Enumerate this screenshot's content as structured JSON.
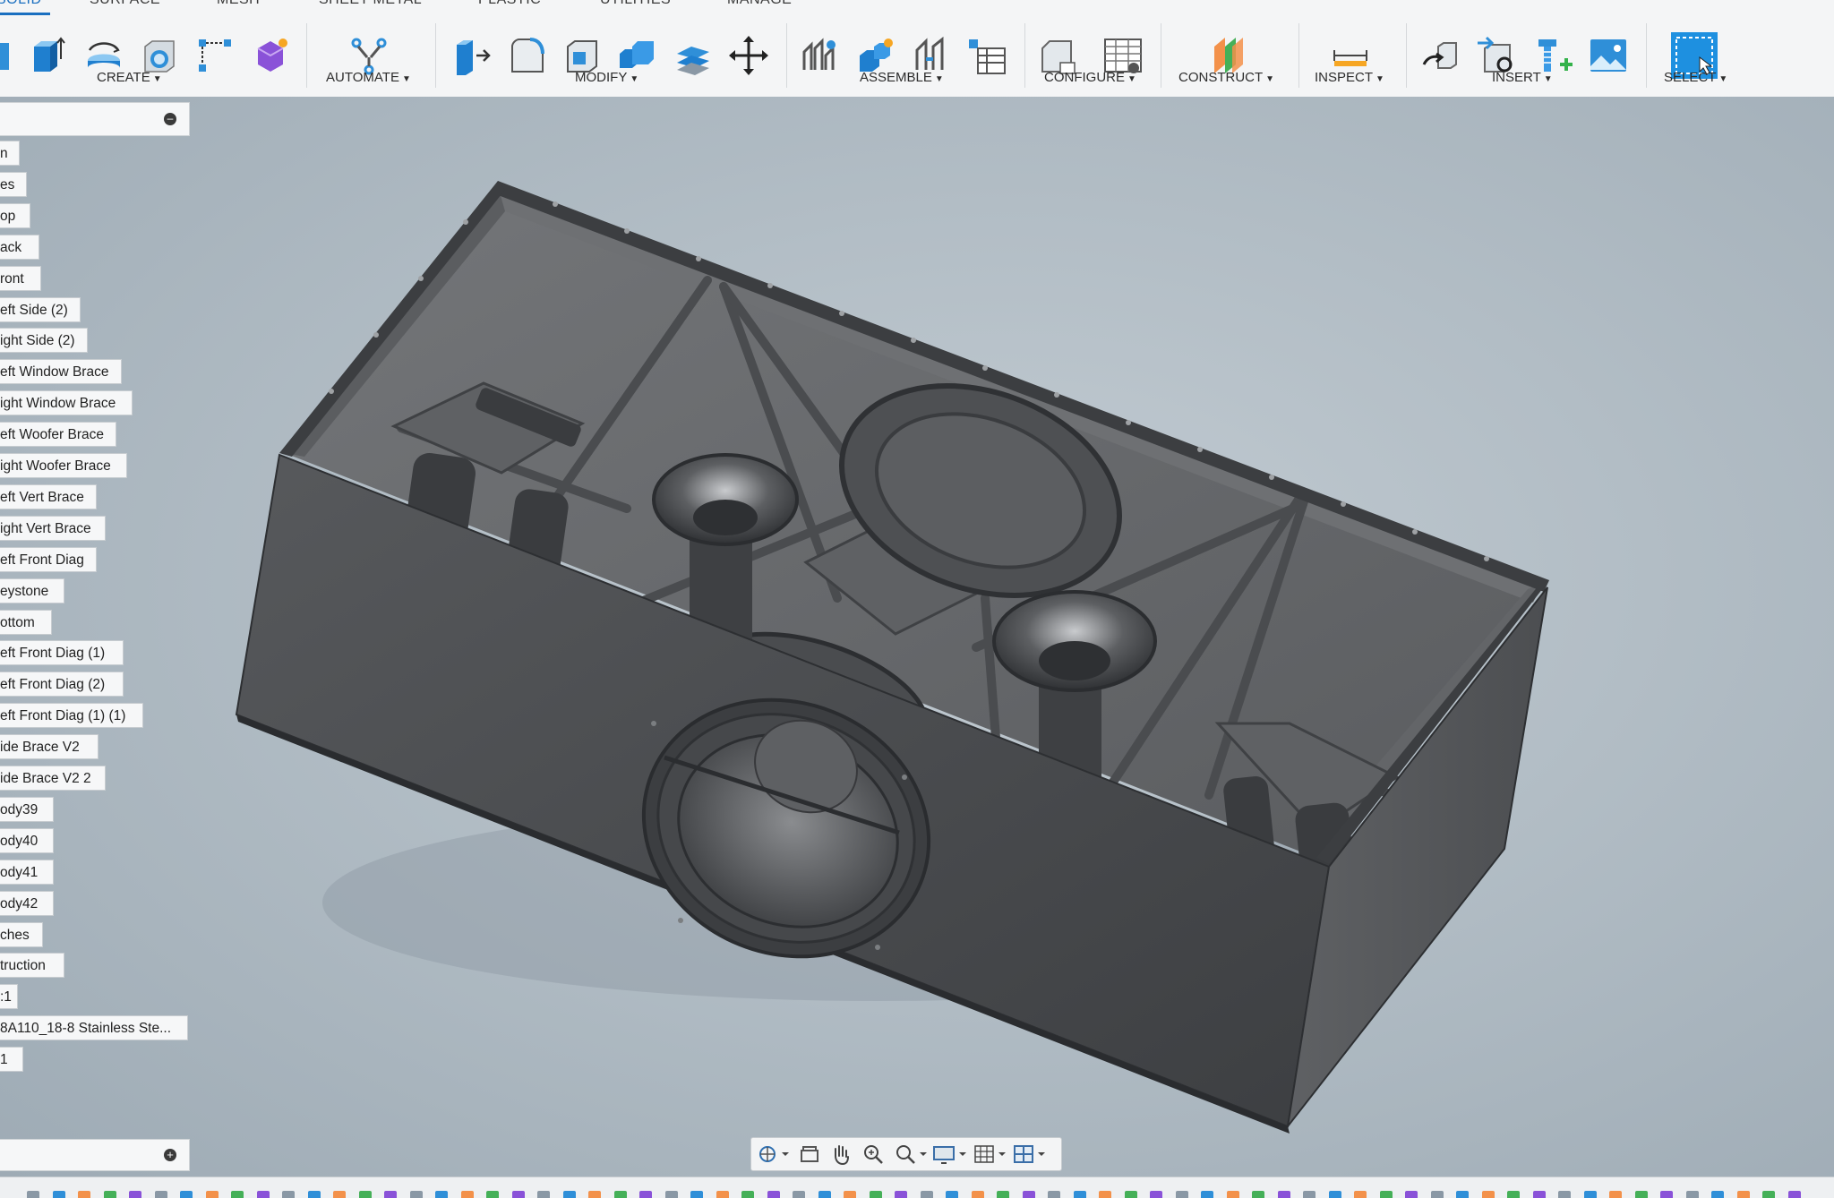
{
  "tabs": [
    {
      "label": "SOLID",
      "active": true
    },
    {
      "label": "SURFACE"
    },
    {
      "label": "MESH"
    },
    {
      "label": "SHEET METAL"
    },
    {
      "label": "PLASTIC"
    },
    {
      "label": "UTILITIES"
    },
    {
      "label": "MANAGE"
    }
  ],
  "toolbar": {
    "create": "CREATE",
    "automate": "AUTOMATE",
    "modify": "MODIFY",
    "assemble": "ASSEMBLE",
    "configure": "CONFIGURE",
    "construct": "CONSTRUCT",
    "inspect": "INSPECT",
    "insert": "INSERT",
    "select": "SELECT"
  },
  "browser": {
    "items": [
      "n",
      "es",
      "op",
      "ack",
      "ront",
      "eft Side (2)",
      "ight Side (2)",
      "eft Window Brace",
      "ight Window Brace",
      "eft Woofer Brace",
      "ight Woofer Brace",
      "eft Vert Brace",
      "ight Vert Brace",
      "eft Front Diag",
      "eystone",
      "ottom",
      "eft Front Diag (1)",
      "eft Front Diag (2)",
      "eft Front Diag (1) (1)",
      "ide Brace V2",
      "ide Brace V2 2",
      "ody39",
      "ody40",
      "ody41",
      "ody42",
      "ches",
      "truction",
      ":1",
      "8A110_18-8 Stainless Ste...",
      "1"
    ]
  },
  "colors": {
    "accent": "#1a6fc0",
    "viewport": "#b2bdc5",
    "model": "#55575a"
  },
  "icons": {
    "browser_collapse": "collapse-icon",
    "comments_expand": "expand-icon"
  }
}
